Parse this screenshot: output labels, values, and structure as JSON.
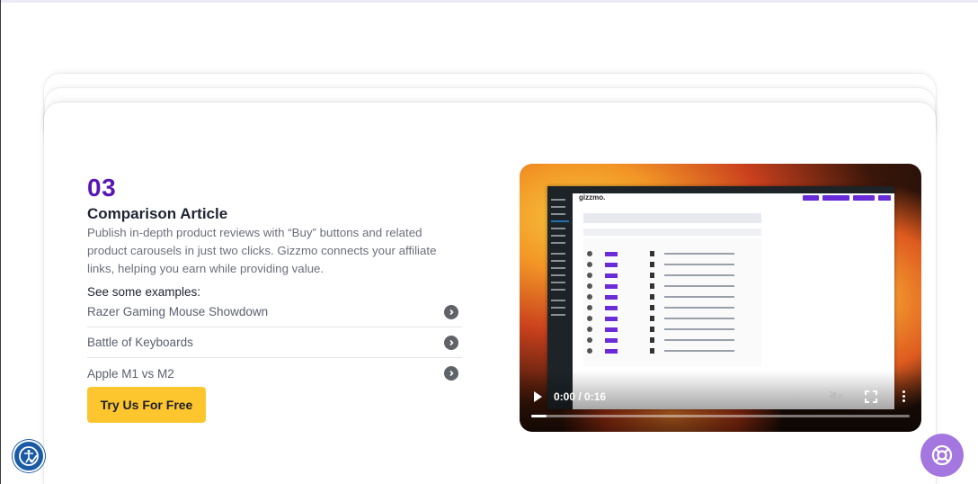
{
  "feature": {
    "step_number": "03",
    "title": "Comparison Article",
    "description": "Publish in-depth product reviews with “Buy” buttons and related product carousels in just two clicks. Gizzmo connects your affiliate links, helping you earn while providing value.",
    "examples_label": "See some examples:",
    "examples": [
      {
        "label": "Razer Gaming Mouse Showdown"
      },
      {
        "label": "Battle of Keyboards"
      },
      {
        "label": "Apple M1 vs M2"
      }
    ],
    "cta_label": "Try Us For Free"
  },
  "video": {
    "time_display": "0:00 / 0:16",
    "progress": 0.0,
    "brand": "gizzmo."
  },
  "colors": {
    "accent_purple": "#5a16b5",
    "cta_yellow": "#fdc62f",
    "help_button": "#a477e0",
    "accessibility_button": "#1b5ba6"
  },
  "icons": {
    "example_chevron": "chevron-right-circle-icon",
    "accessibility": "accessibility-icon",
    "help": "chat-help-icon",
    "play": "play-icon",
    "mute": "volume-muted-icon",
    "fullscreen": "fullscreen-icon",
    "more": "more-vertical-icon"
  }
}
